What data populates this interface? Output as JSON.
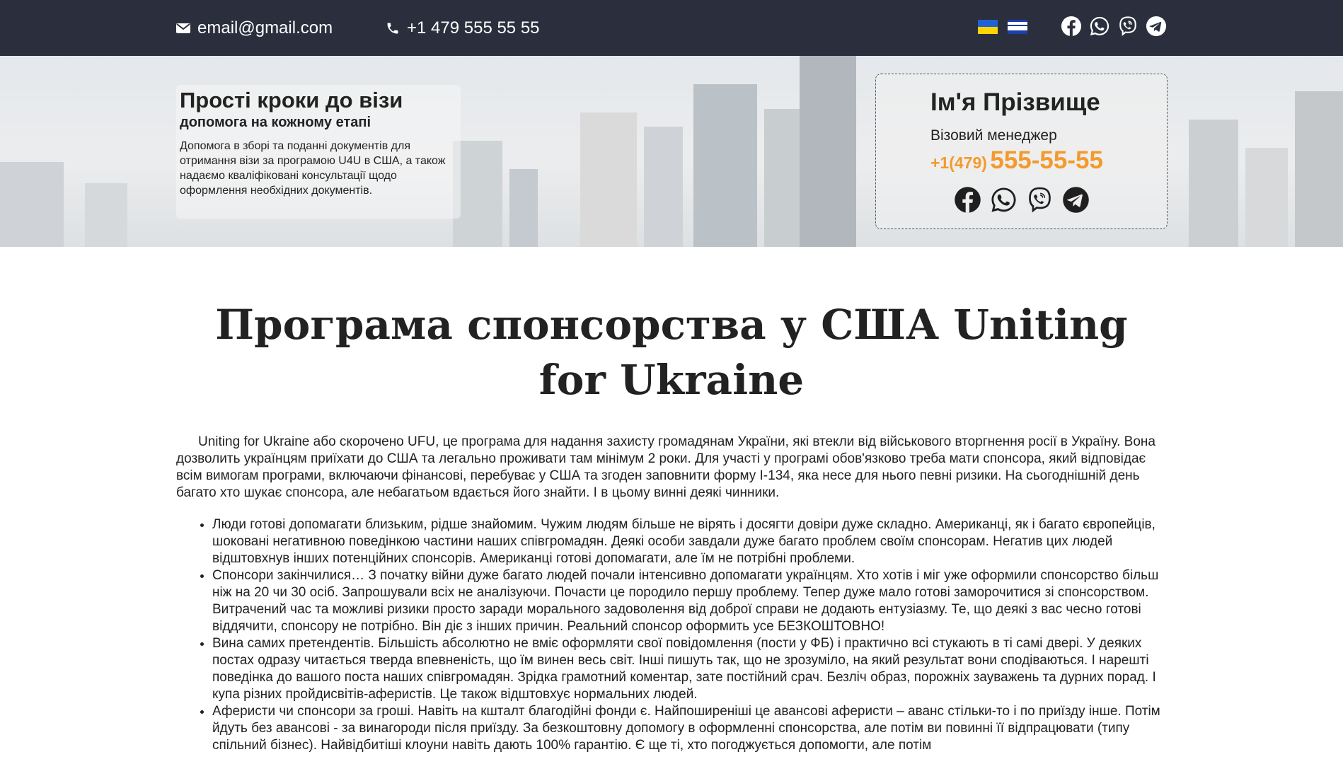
{
  "topbar": {
    "email": "email@gmail.com",
    "phone": "+1 479 555 55 55",
    "flags": [
      "ukraine-flag",
      "israel-flag"
    ],
    "social_icons": [
      "facebook-icon",
      "whatsapp-icon",
      "viber-icon",
      "telegram-icon"
    ]
  },
  "hero": {
    "title": "Прості кроки до візи",
    "subtitle": "допомога на кожному етапі",
    "description": "Допомога в зборі та поданні документів для отримання візи за програмою U4U в США, а також надаємо кваліфіковані консультації щодо оформлення необхідних документів."
  },
  "manager": {
    "name": "Ім'я Прізвище",
    "role": "Візовий менеджер",
    "phone_code": "+1(479)",
    "phone_number": "555-55-55",
    "accent_color": "#f39a2c",
    "social_icons": [
      "facebook-icon",
      "whatsapp-icon",
      "viber-icon",
      "telegram-icon"
    ]
  },
  "main": {
    "title": "Програма спонсорства у США Uniting for Ukraine",
    "lead": "Uniting for Ukraine або скорочено UFU, це програма для надання захисту громадянам України, які втекли від військового вторгнення росії в Україну. Вона дозволить українцям приїхати до США та легально проживати там мінімум 2 роки. Для участі у програмі обов'язково треба мати спонсора, який відповідає всім вимогам програми, включаючи фінансові, перебуває у США та згоден заповнити форму I-134, яка несе для нього певні ризики. На сьогоднішній день багато хто шукає спонсора, але небагатьом вдається його знайти. І в цьому винні деякі чинники.",
    "bullets": [
      "Люди готові допомагати близьким, рідше знайомим. Чужим людям більше не вірять і досягти довіри дуже складно. Американці, як і багато європейців, шоковані негативною поведінкою частини наших співгромадян. Деякі особи завдали дуже багато проблем своїм спонсорам. Негатив цих людей відштовхнув інших потенційних спонсорів. Американці готові допомагати, але їм не потрібні проблеми.",
      "Спонсори закінчилися… З початку війни дуже багато людей почали інтенсивно допомагати українцям. Хто хотів і міг уже оформили спонсорство більш ніж на 20 чи 30 осіб. Запрошували всіх не аналізуючи. Почасти це породило першу проблему. Тепер дуже мало готові заморочитися зі спонсорством. Витрачений час та можливі ризики просто заради морального задоволення від доброї справи не додають ентузіазму. Те, що деякі з вас чесно готові віддячити, спонсору не потрібно. Він діє з інших причин. Реальний спонсор оформить усе БЕЗКОШТОВНО!",
      "Вина самих претендентів. Більшість абсолютно не вміє оформляти свої повідомлення (пости у ФБ) і практично всі стукають в ті самі двері. У деяких постах одразу читається тверда впевненість, що їм винен весь світ. Інші пишуть так, що не зрозуміло, на який результат вони сподіваються. І нарешті поведінка до вашого поста наших співгромадян. Зрідка грамотний коментар, зате постійний срач. Безліч образ, порожніх зауважень та дурних порад. І купа різних пройдисвітів-аферистів. Це також відштовхує нормальних людей.",
      "Аферисти чи спонсори за гроші. Навіть на кшталт благодійні фонди є. Найпоширеніші це авансові аферисти – аванс стільки-то і по приїзду інше. Потім йдуть без авансові - за винагороди після приїзду. За безкоштовну допомогу в оформленні спонсорства, але потім ви повинні її відпрацювати (типу спільний бізнес). Найвідбитіші клоуни навіть дають 100% гарантію. Є ще ті, хто погоджується допомогти, але потім"
    ]
  }
}
